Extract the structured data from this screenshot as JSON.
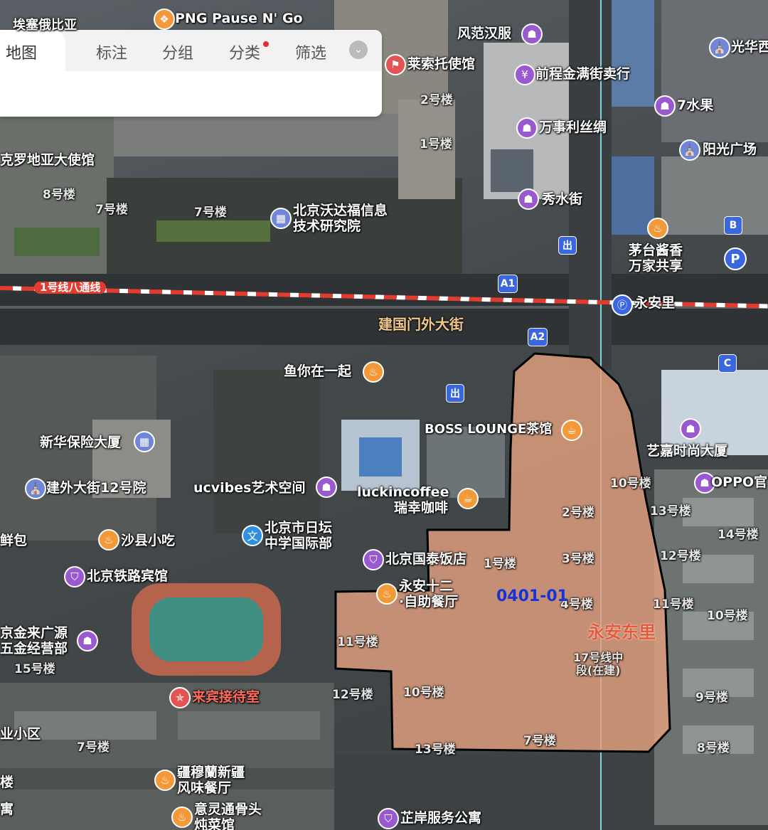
{
  "toolbar": {
    "tabs": [
      "地图",
      "标注",
      "分组",
      "分类",
      "筛选"
    ],
    "collapse_icon": "chevron-down-icon"
  },
  "parcel": {
    "code": "0401-01",
    "district": "永安东里",
    "construction_note_1": "17号线中",
    "construction_note_2": "段(在建)",
    "fill_color": "#e3a07f",
    "outline_color": "#000000"
  },
  "road": {
    "main_street": "建国门外大街",
    "subway_line": "1号线八通线",
    "subway_color": "#e23b2f",
    "station": "永安里"
  },
  "markers": {
    "exit1": "出",
    "exit2": "出",
    "a1": "A1",
    "a2": "A2",
    "b": "B",
    "c": "C",
    "p": "P"
  },
  "pois": {
    "png": "PNG Pause N' Go",
    "top_left_cut": "埃塞俄比亚",
    "fanfan": "风范汉服",
    "laisuo": "莱索托使馆",
    "qiancheng": "前程金满街卖行",
    "guanghua": "光华西",
    "shuiguo": "7水果",
    "wanshili": "万事利丝绸",
    "yangguang": "阳光广场",
    "xiushui": "秀水街",
    "woda_1": "北京沃达福信息",
    "woda_2": "技术研究院",
    "maotai_1": "茅台酱香",
    "maotai_2": "万家共享",
    "croatia": "克罗地亚大使馆",
    "yuniyiqi": "鱼你在一起",
    "xinhua": "新华保险大厦",
    "jianwai12": "建外大街12号院",
    "boss": "BOSS LOUNGE茶馆",
    "yijia": "艺嘉时尚大厦",
    "oppo": "OPPO官",
    "ucvibes": "ucvibes艺术空间",
    "luckin_1": "luckincoffee",
    "luckin_2": "瑞幸咖啡",
    "shaxian": "沙县小吃",
    "xianbao": "鲜包",
    "ritan_1": "北京市日坛",
    "ritan_2": "中学国际部",
    "guotai": "北京国泰饭店",
    "yongan12_1": "永安十二",
    "yongan12_2": "·自助餐厅",
    "tielu": "北京铁路宾馆",
    "jinlai_1": "京金来广源",
    "jinlai_2": "五金经营部",
    "laibin": "来宾接待室",
    "xiaoqu": "业小区",
    "jiangmu_1": "疆穆蘭新疆",
    "jiangmu_2": "风味餐厅",
    "yiling_1": "意灵通骨头",
    "yiling_2": "炖菜馆",
    "zhian": "芷岸服务公寓",
    "bottom_left": "寓",
    "bottom_left_2": "楼"
  },
  "buildings": {
    "b2_top": "2号楼",
    "b1_top": "1号楼",
    "b8_left": "8号楼",
    "b7_left1": "7号楼",
    "b7_left2": "7号楼",
    "b10_r": "10号楼",
    "b2_r": "2号楼",
    "b13_r": "13号楼",
    "b14_r": "14号楼",
    "b3": "3号楼",
    "b12_r": "12号楼",
    "b1_mid": "1号楼",
    "b4": "4号楼",
    "b11_r": "11号楼",
    "b10_rr": "10号楼",
    "b11_l": "11号楼",
    "b15": "15号楼",
    "b12_l": "12号楼",
    "b10_l": "10号楼",
    "b9": "9号楼",
    "b7_low": "7号楼",
    "b13_low": "13号楼",
    "b8_low": "8号楼",
    "b7_bl": "7号楼"
  }
}
